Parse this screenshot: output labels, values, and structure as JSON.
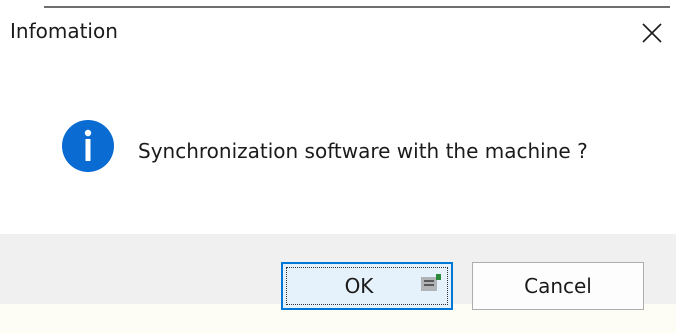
{
  "window": {
    "title": "Infomation"
  },
  "message": {
    "text": "Synchronization software with the machine ?"
  },
  "buttons": {
    "ok_label": "OK",
    "cancel_label": "Cancel"
  },
  "icons": {
    "info": "info-icon",
    "close": "close-icon"
  },
  "colors": {
    "info_icon": "#0a6cd2",
    "focus_border": "#0078d7",
    "button_bar": "#f0f0f0"
  }
}
